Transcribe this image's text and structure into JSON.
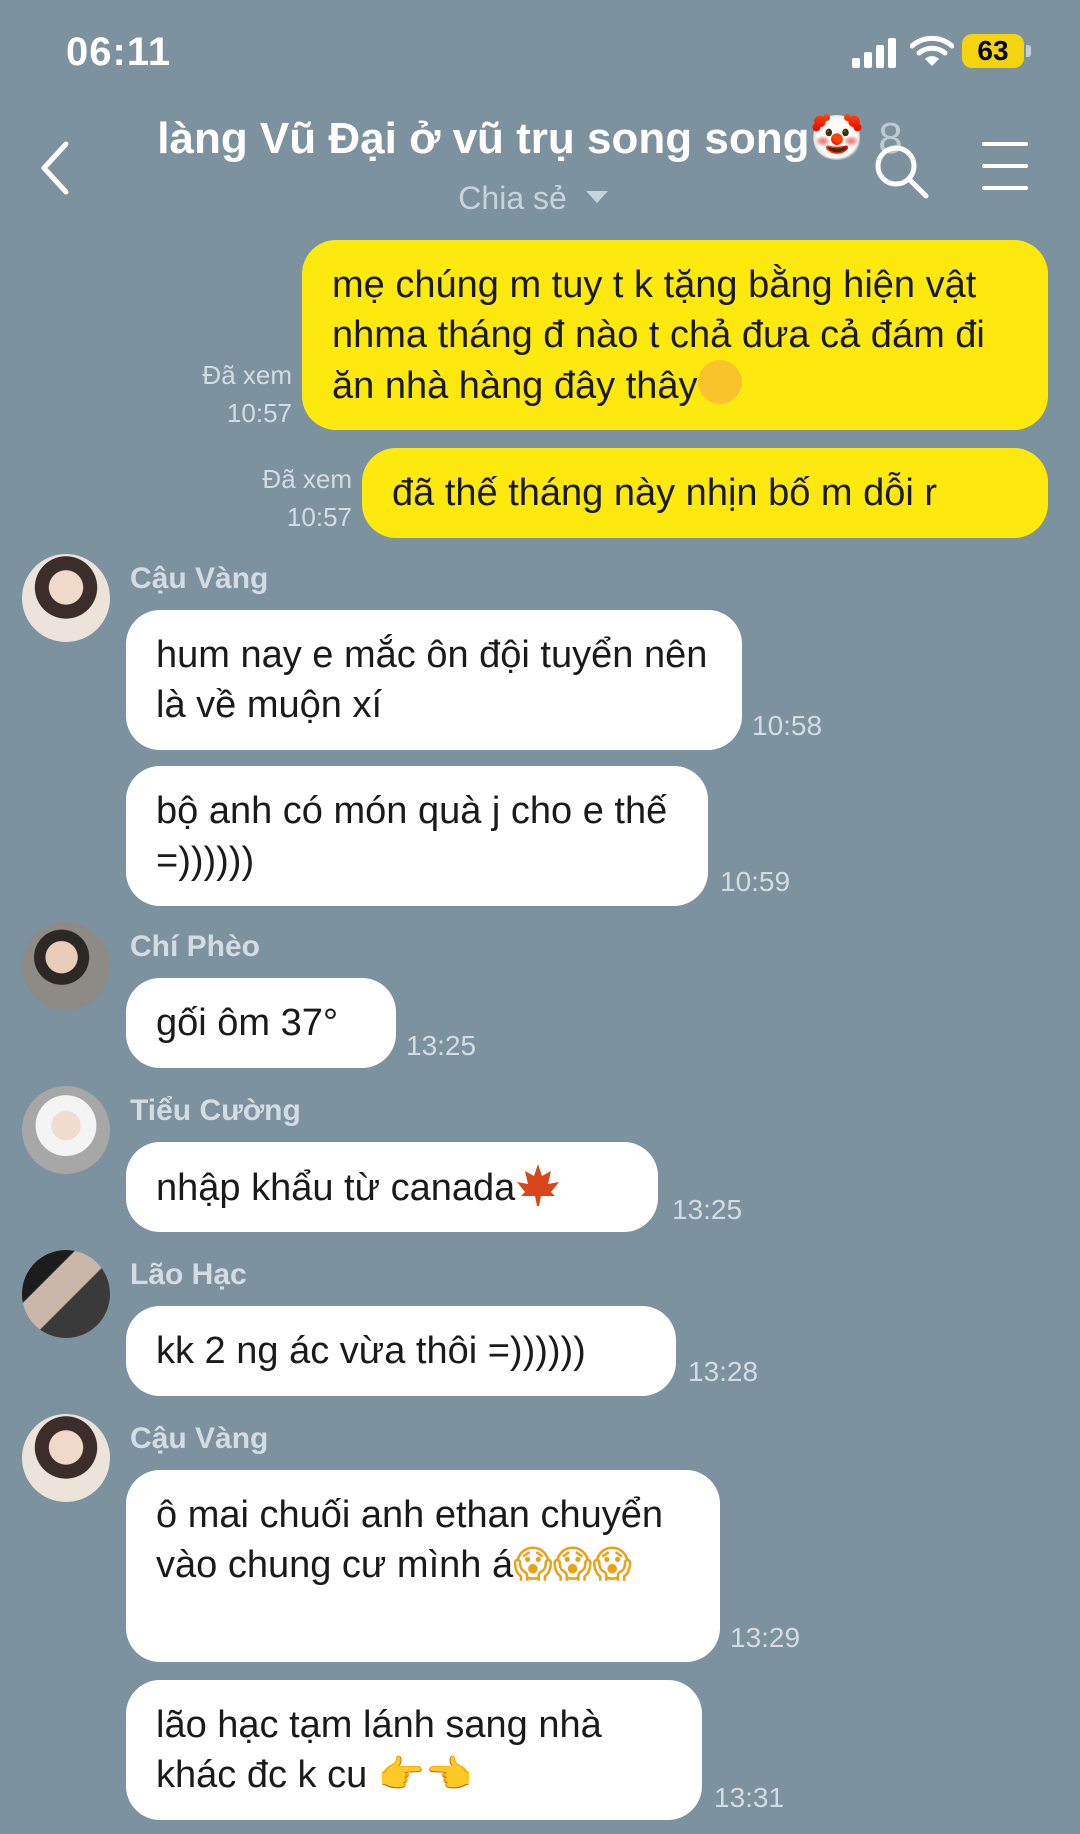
{
  "status_bar": {
    "time": "06:11",
    "battery": "63"
  },
  "header": {
    "title": "làng Vũ Đại ở vũ trụ song song",
    "title_emoji": "🤡",
    "member_count": "8",
    "subtitle": "Chia sẻ"
  },
  "messages": {
    "m1": {
      "text": "mẹ chúng m tuy t k tặng bằng hiện vật nhma tháng đ nào t chả đưa cả đám đi ăn nhà hàng đây thây",
      "emoji": "😀",
      "seen": "Đã xem",
      "time": "10:57"
    },
    "m2": {
      "text": "đã thế tháng này nhịn bố m dỗi r",
      "seen": "Đã xem",
      "time": "10:57"
    },
    "m3": {
      "sender": "Cậu Vàng",
      "text": "hum nay e mắc ôn đội tuyển nên là về muộn xí",
      "time": "10:58"
    },
    "m4": {
      "text": "bộ anh có món quà j cho e thế =))))))",
      "time": "10:59"
    },
    "m5": {
      "sender": "Chí Phèo",
      "text": "gối ôm 37°",
      "time": "13:25"
    },
    "m6": {
      "sender": "Tiểu Cường",
      "text": "nhập khẩu từ canada",
      "emoji": "🍁",
      "time": "13:25"
    },
    "m7": {
      "sender": "Lão Hạc",
      "text": "kk 2 ng ác vừa thôi =))))))",
      "time": "13:28"
    },
    "m8": {
      "sender": "Cậu Vàng",
      "text": "ô mai chuối anh ethan chuyển vào chung cư mình á",
      "emoji": "😱😱😱",
      "time": "13:29"
    },
    "m9": {
      "text": "lão hạc tạm lánh sang nhà khác đc k cu",
      "emoji": "👉👈",
      "time": "13:31"
    }
  },
  "colors": {
    "background": "#7c929f",
    "my_bubble": "#fde90e",
    "their_bubble": "#ffffff"
  }
}
